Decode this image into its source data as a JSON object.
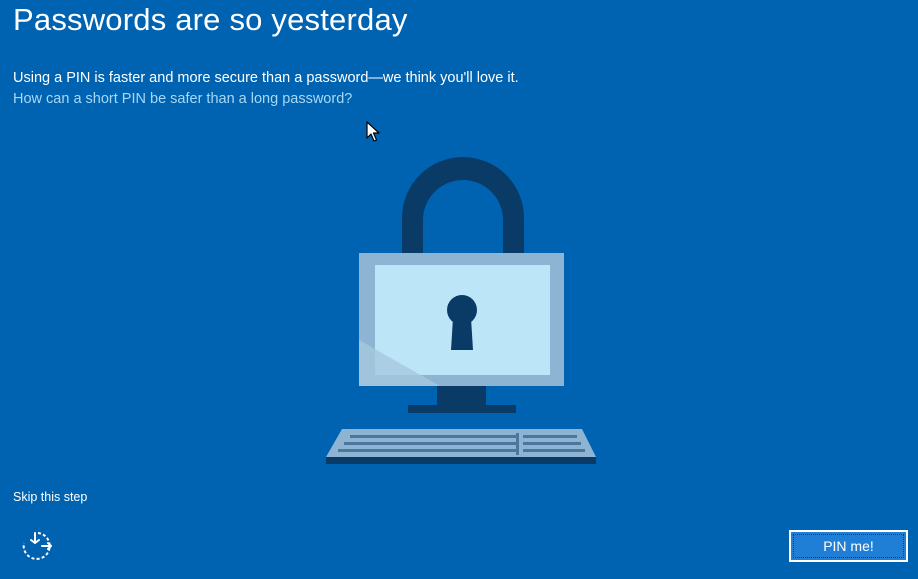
{
  "header": {
    "title": "Passwords are so yesterday",
    "subtitle": "Using a PIN is faster and more secure than a password—we think you'll love it.",
    "help_link": "How can a short PIN be safer than a long password?"
  },
  "illustration": {
    "icon": "lock-computer-illustration",
    "colors": {
      "shackle": "#0A3A66",
      "monitor_frame": "#8DB5D3",
      "screen": "#BCE6F8",
      "keyhole": "#0A3A66",
      "keyboard": "#8DB5D3"
    }
  },
  "footer": {
    "skip_label": "Skip this step",
    "accessibility_icon": "ease-of-access-icon",
    "primary_button_label": "PIN me!"
  },
  "colors": {
    "background": "#0063B1",
    "link": "#A6D8F7",
    "button_bg": "#1F7FD6"
  }
}
